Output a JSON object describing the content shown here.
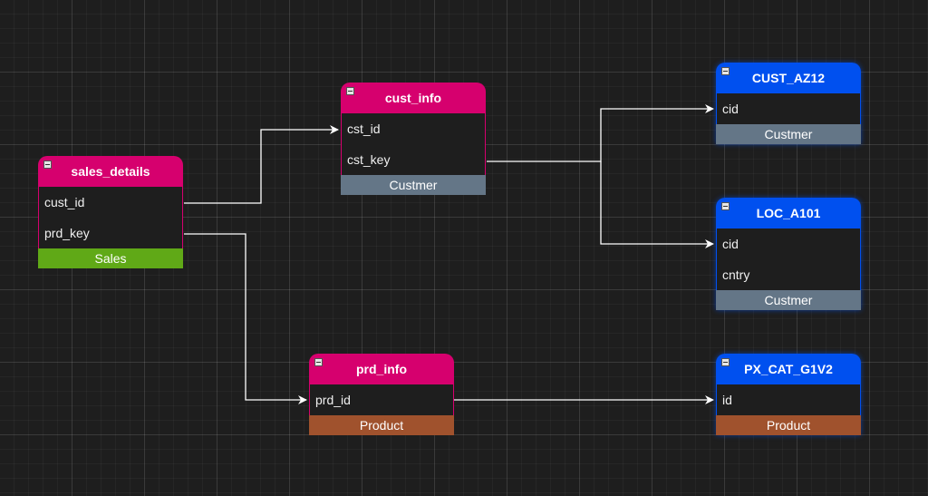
{
  "diagram": {
    "tables": {
      "sales_details": {
        "title": "sales_details",
        "rows": [
          "cust_id",
          "prd_key"
        ],
        "footer": "Sales",
        "header_color": "#d6006e",
        "footer_color": "#60a917"
      },
      "cust_info": {
        "title": "cust_info",
        "rows": [
          "cst_id",
          "cst_key"
        ],
        "footer": "Custmer",
        "header_color": "#d6006e",
        "footer_color": "#647687"
      },
      "prd_info": {
        "title": "prd_info",
        "rows": [
          "prd_id"
        ],
        "footer": "Product",
        "header_color": "#d6006e",
        "footer_color": "#a0522d"
      },
      "cust_az12": {
        "title": "CUST_AZ12",
        "rows": [
          "cid"
        ],
        "footer": "Custmer",
        "header_color": "#0050ef",
        "footer_color": "#647687"
      },
      "loc_a101": {
        "title": "LOC_A101",
        "rows": [
          "cid",
          "cntry"
        ],
        "footer": "Custmer",
        "header_color": "#0050ef",
        "footer_color": "#647687"
      },
      "px_cat_g1v2": {
        "title": "PX_CAT_G1V2",
        "rows": [
          "id"
        ],
        "footer": "Product",
        "header_color": "#0050ef",
        "footer_color": "#a0522d"
      }
    },
    "connections": [
      {
        "from": "sales_details.cust_id",
        "to": "cust_info.cst_id"
      },
      {
        "from": "sales_details.prd_key",
        "to": "prd_info.prd_id"
      },
      {
        "from": "cust_info.cst_key",
        "to": "cust_az12.cid"
      },
      {
        "from": "cust_info.cst_key",
        "to": "loc_a101.cid"
      },
      {
        "from": "prd_info.prd_id",
        "to": "px_cat_g1v2.id"
      }
    ],
    "connector_color": "#ffffff"
  }
}
